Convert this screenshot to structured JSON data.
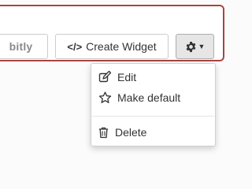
{
  "toolbar": {
    "share_label": "bitly",
    "create_widget_label": "Create Widget",
    "code_icon": "</>",
    "settings_icon": "gear-icon"
  },
  "dropdown": {
    "items": [
      {
        "label": "Edit",
        "icon": "edit-icon"
      },
      {
        "label": "Make default",
        "icon": "star-outline-icon"
      },
      {
        "label": "Delete",
        "icon": "trash-icon"
      }
    ]
  },
  "colors": {
    "panel_border": "#a94442",
    "button_border": "#cccccc",
    "active_button_bg": "#e6e6e6"
  }
}
